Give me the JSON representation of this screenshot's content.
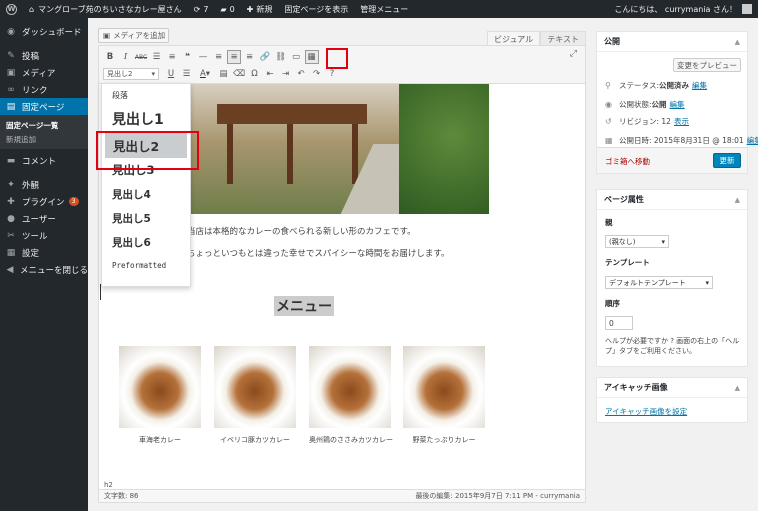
{
  "adminbar": {
    "logo": "W",
    "site_name": "マングローブ苑のちいさなカレー屋さん",
    "updates_count": "7",
    "comments_count": "0",
    "new_label": "新規",
    "view_page": "固定ページを表示",
    "admin_menu": "管理メニュー",
    "greeting": "こんにちは、 currymania さん！"
  },
  "sidebar": {
    "items": [
      {
        "icon": "dashboard-icon",
        "glyph": "◉",
        "label": "ダッシュボード"
      },
      {
        "icon": "pin-icon",
        "glyph": "✎",
        "label": "投稿"
      },
      {
        "icon": "media-icon",
        "glyph": "▣",
        "label": "メディア"
      },
      {
        "icon": "link-icon",
        "glyph": "∞",
        "label": "リンク"
      },
      {
        "icon": "pages-icon",
        "glyph": "▤",
        "label": "固定ページ"
      },
      {
        "icon": "comments-icon",
        "glyph": "▬",
        "label": "コメント"
      },
      {
        "icon": "appearance-icon",
        "glyph": "✦",
        "label": "外観"
      },
      {
        "icon": "plugins-icon",
        "glyph": "✚",
        "label": "プラグイン",
        "badge": "3"
      },
      {
        "icon": "users-icon",
        "glyph": "●",
        "label": "ユーザー"
      },
      {
        "icon": "tools-icon",
        "glyph": "✂",
        "label": "ツール"
      },
      {
        "icon": "settings-icon",
        "glyph": "▦",
        "label": "設定"
      },
      {
        "icon": "collapse-icon",
        "glyph": "◀",
        "label": "メニューを閉じる"
      }
    ],
    "sub_pages_all": "固定ページ一覧",
    "sub_pages_new": "新規追加"
  },
  "editor": {
    "add_media": "メディアを追加",
    "tab_visual": "ビジュアル",
    "tab_text": "テキスト",
    "format_select": "見出し2",
    "paragraph1": "当店は本格的なカレーの食べられる新しい形のカフェです。",
    "paragraph2": "ちょっといつもとは違った幸せでスパイシーな時間をお届けします。",
    "menu_heading": "メニュー",
    "dishes": [
      {
        "caption": "車海老カレー"
      },
      {
        "caption": "イベリコ豚カツカレー"
      },
      {
        "caption": "奥州鶏のささみカツカレー"
      },
      {
        "caption": "野菜たっぷりカレー"
      }
    ],
    "path": "h2",
    "word_count": "文字数: 86",
    "last_edited": "最後の編集: 2015年9月7日 7:11 PM - currymania"
  },
  "format_menu": {
    "paragraph": "段落",
    "h1": "見出し1",
    "h2": "見出し2",
    "h3": "見出し3",
    "h4": "見出し4",
    "h5": "見出し5",
    "h6": "見出し6",
    "pre": "Preformatted"
  },
  "publish": {
    "title": "公開",
    "preview": "変更をプレビュー",
    "status_label": "ステータス: ",
    "status_value": "公開済み",
    "visibility_label": "公開状態: ",
    "visibility_value": "公開",
    "revisions_label": "リビジョン: 12",
    "revisions_link": "表示",
    "date_label": "公開日時: 2015年8月31日 @ 18:01",
    "edit": "編集",
    "trash": "ゴミ箱へ移動",
    "update": "更新"
  },
  "page_attributes": {
    "title": "ページ属性",
    "parent_label": "親",
    "parent_value": "(親なし)",
    "template_label": "テンプレート",
    "template_value": "デフォルトテンプレート",
    "order_label": "順序",
    "order_value": "0",
    "help": "ヘルプが必要ですか ? 画面の右上の「ヘルプ」タブをご利用ください。"
  },
  "featured": {
    "title": "アイキャッチ画像",
    "link": "アイキャッチ画像を設定"
  }
}
